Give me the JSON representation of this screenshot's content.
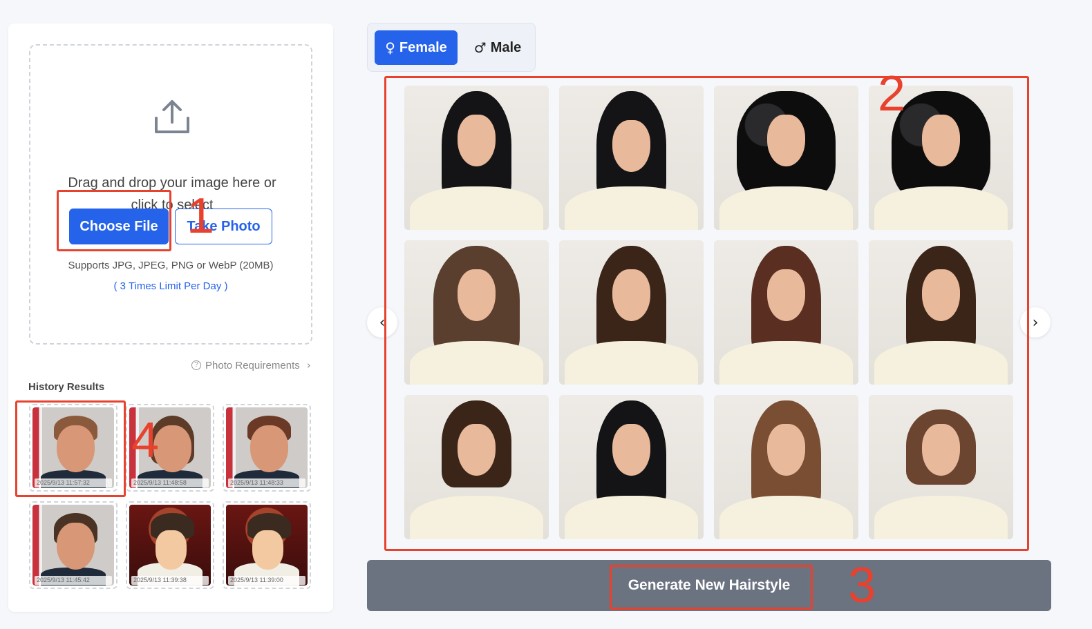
{
  "upload": {
    "prompt": "Drag and drop your image here or click to select",
    "choose_file_label": "Choose File",
    "take_photo_label": "Take Photo",
    "supports_text": "Supports JPG, JPEG, PNG or WebP (20MB)",
    "limit_text": "( 3 Times Limit Per Day )",
    "icon": "upload-icon"
  },
  "photo_requirements": {
    "label": "Photo Requirements",
    "icon": "question-circle-icon"
  },
  "history": {
    "title": "History Results",
    "items": [
      {
        "timestamp": "2025/9/13 11:57:32"
      },
      {
        "timestamp": "2025/9/13 11:48:58"
      },
      {
        "timestamp": "2025/9/13 11:48:33"
      },
      {
        "timestamp": "2025/9/13 11:45:42"
      },
      {
        "timestamp": "2025/9/13 11:39:38"
      },
      {
        "timestamp": "2025/9/13 11:39:00"
      }
    ]
  },
  "gender": {
    "female_label": "Female",
    "female_icon": "♀",
    "male_label": "Male",
    "male_icon": "♂",
    "selected": "Female"
  },
  "hairstyles": {
    "count": 12
  },
  "carousel": {
    "prev_icon": "‹",
    "next_icon": "›"
  },
  "generate": {
    "label": "Generate New Hairstyle"
  },
  "annotations": [
    "1",
    "2",
    "3",
    "4"
  ],
  "colors": {
    "primary": "#2563eb",
    "annotation": "#e8412e",
    "generate_bg": "#6b7280",
    "page_bg": "#f5f7fa"
  }
}
